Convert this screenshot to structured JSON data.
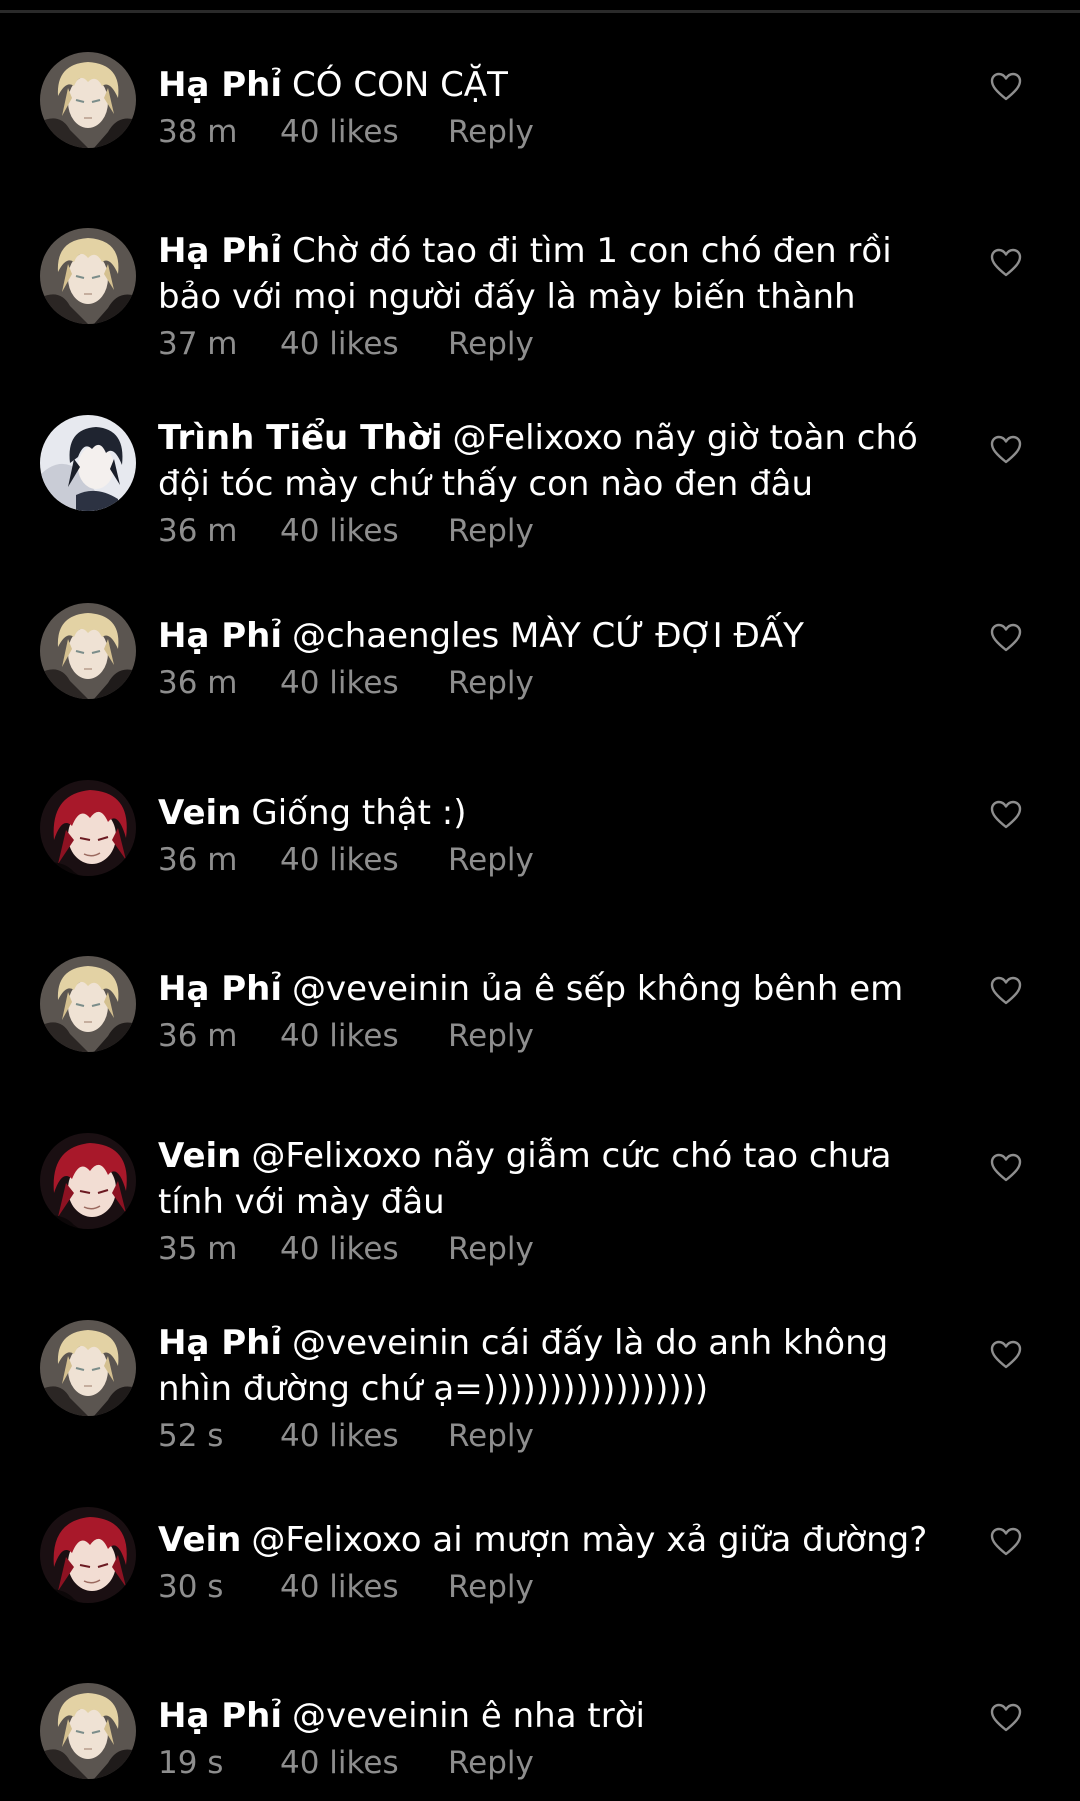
{
  "comments": [
    {
      "user": "Hạ Phỉ",
      "avatar": "blonde-avatar",
      "text": "CÓ CON CẶT",
      "time": "38 m",
      "likes": "40 likes",
      "reply": "Reply"
    },
    {
      "user": "Hạ Phỉ",
      "avatar": "blonde-avatar",
      "text": "Chờ đó tao đi tìm 1 con chó đen rồi bảo với mọi người đấy là mày biến thành",
      "time": "37 m",
      "likes": "40 likes",
      "reply": "Reply"
    },
    {
      "user": "Trình Tiểu Thời",
      "avatar": "darkhair-avatar",
      "text": "@Felixoxo nãy giờ toàn chó đội tóc mày chứ thấy con nào đen đâu",
      "time": "36 m",
      "likes": "40 likes",
      "reply": "Reply"
    },
    {
      "user": "Hạ Phỉ",
      "avatar": "blonde-avatar",
      "text": "@chaengles MÀY CỨ ĐỢI ĐẤY",
      "time": "36 m",
      "likes": "40 likes",
      "reply": "Reply"
    },
    {
      "user": "Vein",
      "avatar": "redhair-avatar",
      "text": "Giống thật :)",
      "time": "36 m",
      "likes": "40 likes",
      "reply": "Reply"
    },
    {
      "user": "Hạ Phỉ",
      "avatar": "blonde-avatar",
      "text": "@veveinin ủa ê sếp không bênh em",
      "time": "36 m",
      "likes": "40 likes",
      "reply": "Reply"
    },
    {
      "user": "Vein",
      "avatar": "redhair-avatar",
      "text": "@Felixoxo nãy giẫm cức chó tao chưa tính với mày đâu",
      "time": "35 m",
      "likes": "40 likes",
      "reply": "Reply"
    },
    {
      "user": "Hạ Phỉ",
      "avatar": "blonde-avatar",
      "text": "@veveinin cái đấy là do anh không nhìn đường chứ ạ=)))))))))))))))))",
      "time": "52 s",
      "likes": "40 likes",
      "reply": "Reply"
    },
    {
      "user": "Vein",
      "avatar": "redhair-avatar",
      "text": "@Felixoxo ai mượn mày xả giữa đường?",
      "time": "30 s",
      "likes": "40 likes",
      "reply": "Reply"
    },
    {
      "user": "Hạ Phỉ",
      "avatar": "blonde-avatar",
      "text": "@veveinin ê nha trời",
      "time": "19 s",
      "likes": "40 likes",
      "reply": "Reply"
    }
  ],
  "icons": {
    "like": "heart-outline-icon"
  },
  "colors": {
    "background": "#000000",
    "text": "#ffffff",
    "meta": "#8e8e8e"
  }
}
